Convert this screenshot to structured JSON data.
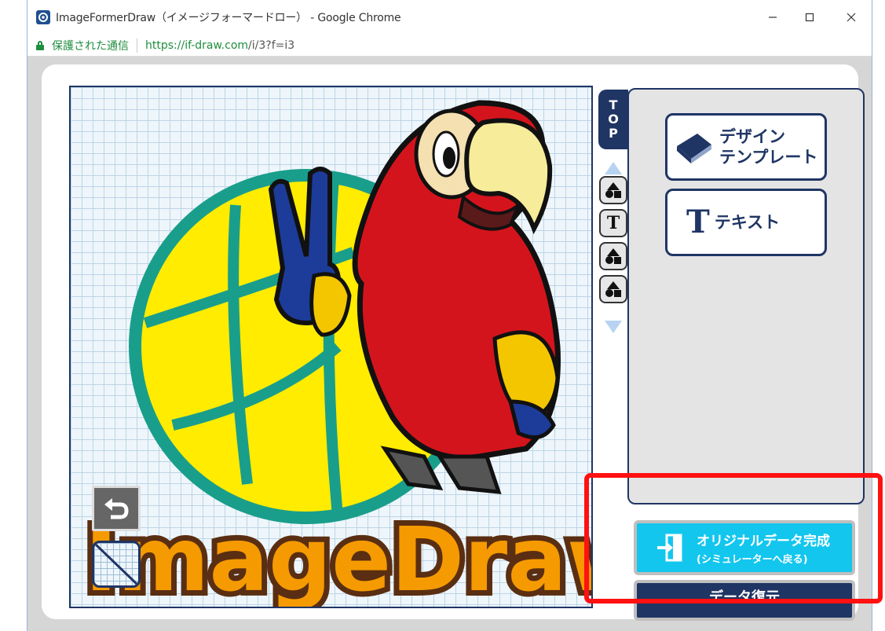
{
  "window": {
    "title": "ImageFormerDraw（イメージフォーマードロー） - Google Chrome",
    "controls": {
      "minimize": "—",
      "maximize": "☐",
      "close": "✕"
    }
  },
  "address_bar": {
    "security_label": "保護された通信",
    "url_scheme": "https://",
    "url_host": "if-draw.com",
    "url_path": "/i/3?f=i3"
  },
  "canvas": {
    "logo_text": "ImageDraw"
  },
  "sidebar": {
    "top_tab": [
      "T",
      "O",
      "P"
    ],
    "tools": [
      {
        "kind": "shape",
        "icon": "shapes-icon"
      },
      {
        "kind": "text",
        "label": "T",
        "icon": "text-tool-icon"
      },
      {
        "kind": "shape",
        "icon": "shapes-icon"
      },
      {
        "kind": "shape",
        "icon": "shapes-icon"
      }
    ]
  },
  "menu": {
    "design_template": {
      "line1": "デザイン",
      "line2": "テンプレート"
    },
    "text": {
      "icon_letter": "T",
      "label": "テキスト"
    }
  },
  "actions": {
    "finish_line1": "オリジナルデータ完成",
    "finish_line2": "(シミュレーターへ戻る)",
    "secondary_label": "データ復元"
  },
  "colors": {
    "navy": "#1f3564",
    "cyan_button": "#12c6ee",
    "highlight_red": "#ff1111",
    "secure_green": "#1e8e3e"
  }
}
